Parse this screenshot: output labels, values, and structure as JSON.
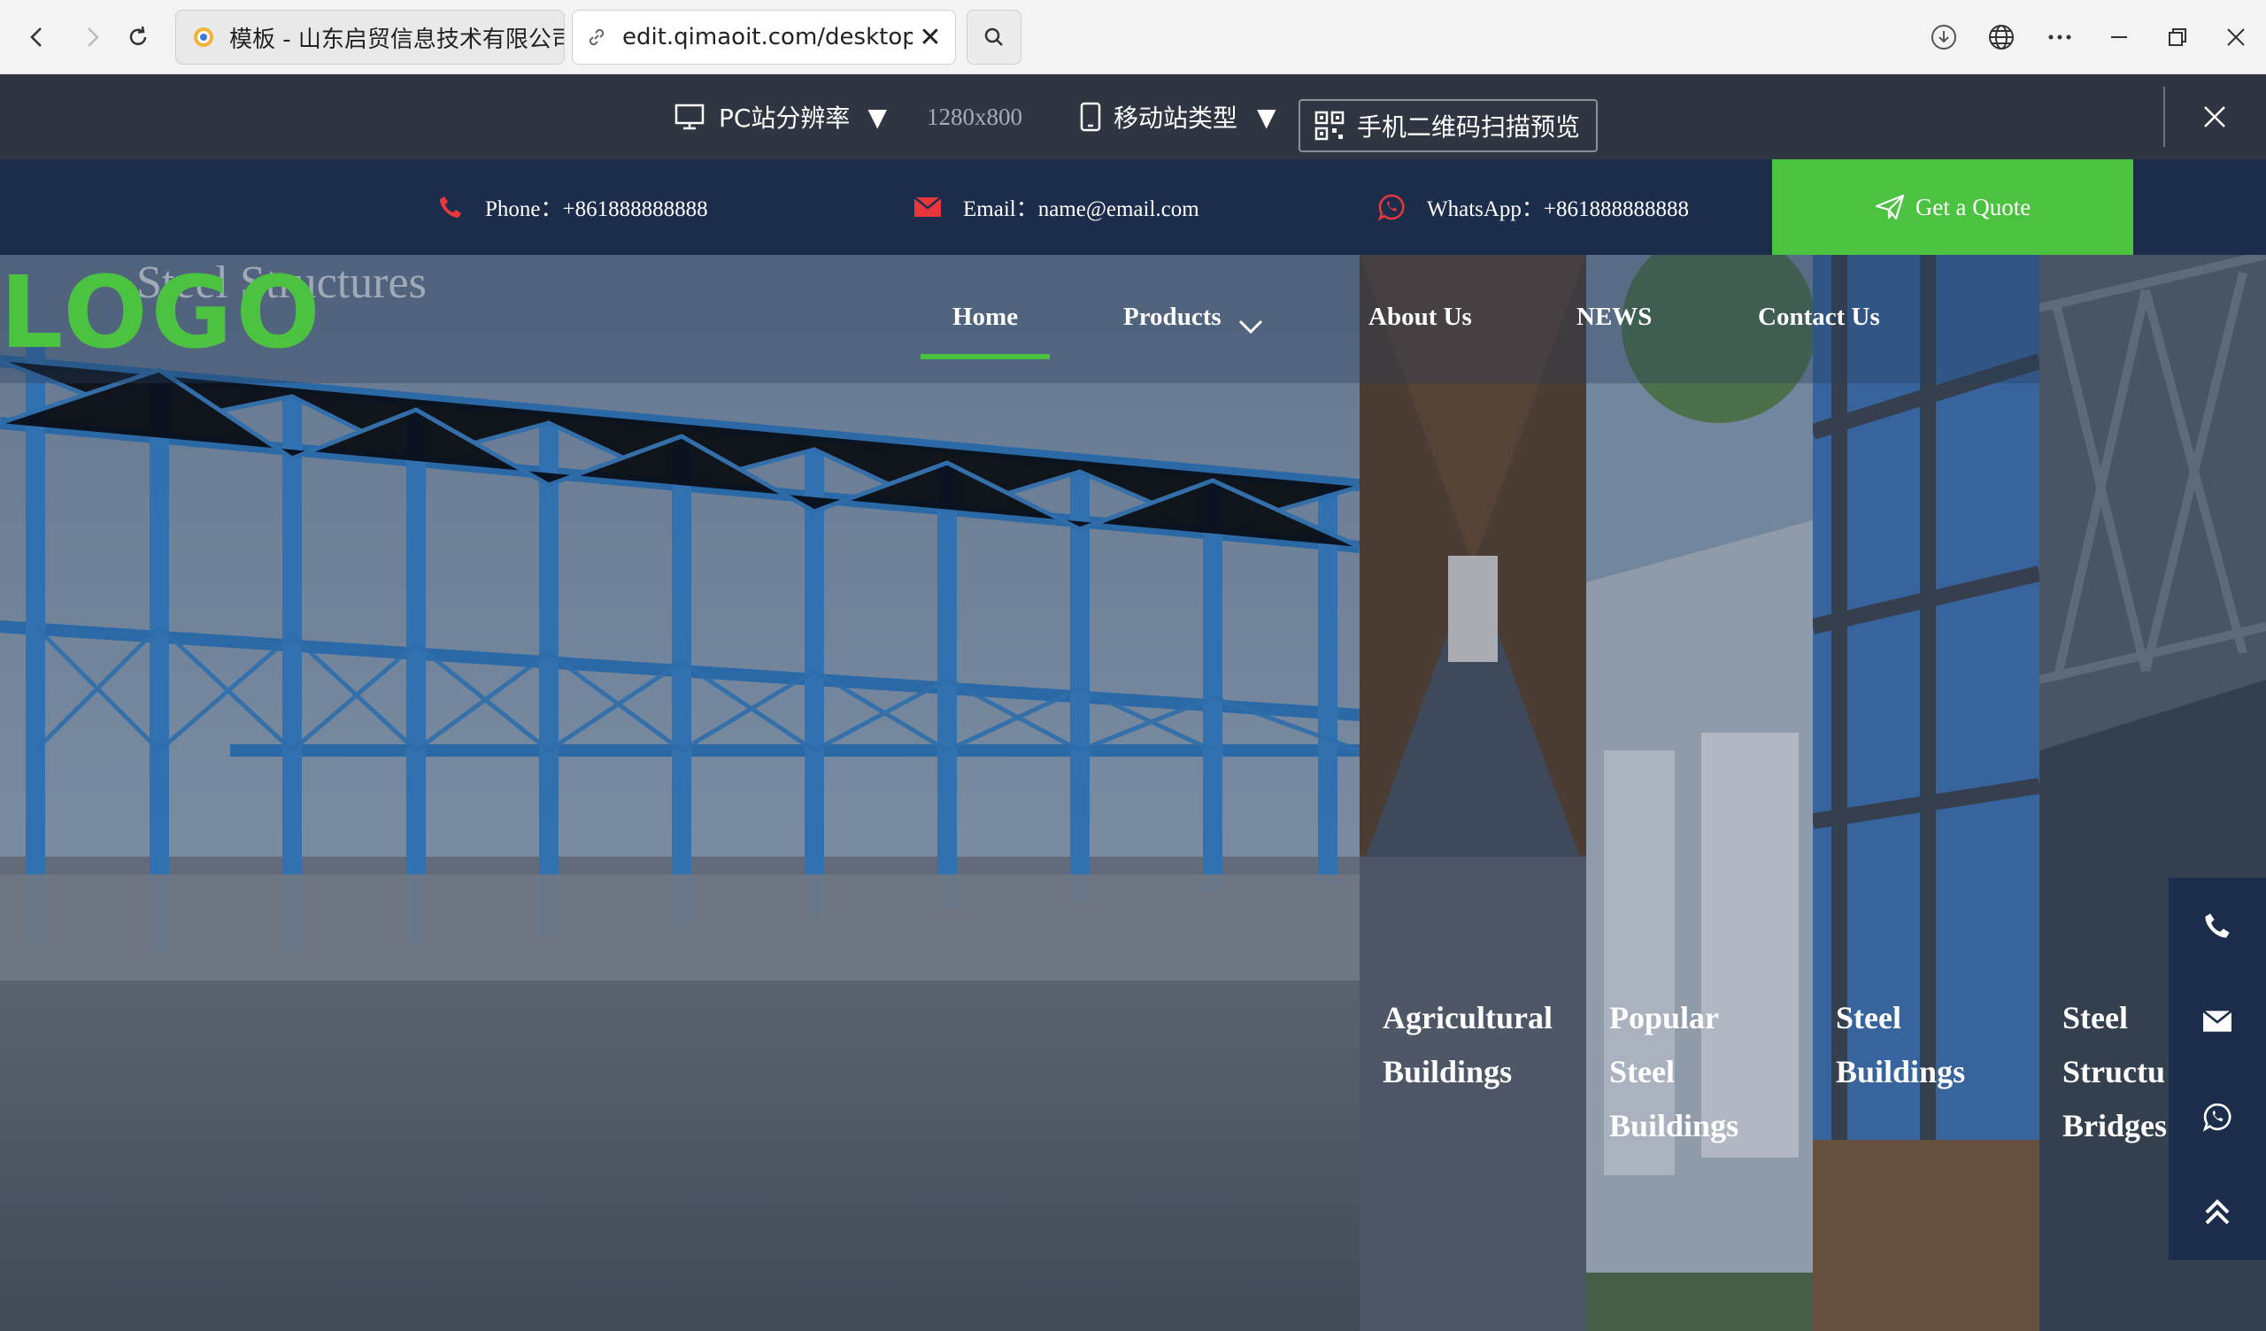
{
  "browser": {
    "tabs": [
      {
        "title": "模板 - 山东启贸信息技术有限公司",
        "active": false
      },
      {
        "title": "edit.qimaoit.com/desktop/h",
        "active": true
      }
    ],
    "icons": [
      "back-icon",
      "forward-icon",
      "reload-icon",
      "search-icon",
      "download-icon",
      "globe-icon",
      "more-icon",
      "minimize-icon",
      "restore-icon",
      "close-icon"
    ]
  },
  "preview_bar": {
    "pc_label": "PC站分辨率",
    "resolution": "1280x800",
    "mobile_label": "移动站类型",
    "qr_label": "手机二维码扫描预览",
    "arrow": "▼"
  },
  "contact": {
    "phone": "Phone：+861888888888",
    "email": "Email：name@email.com",
    "whatsapp": "WhatsApp：+861888888888",
    "quote": "Get a Quote"
  },
  "header": {
    "logo": "LOGO",
    "logo_subtitle": "Steel Structures",
    "nav": [
      {
        "label": "Home",
        "active": true
      },
      {
        "label": "Products",
        "has_dropdown": true
      },
      {
        "label": "About Us"
      },
      {
        "label": "NEWS"
      },
      {
        "label": "Contact Us"
      }
    ]
  },
  "hero": {
    "panels": [
      {
        "label": "Agricultural\nBuildings"
      },
      {
        "label": "Popular\nSteel\nBuildings"
      },
      {
        "label": "Steel\nBuildings"
      },
      {
        "label": "Steel\nStructu\nBridges"
      }
    ]
  },
  "colors": {
    "accent_green": "#4cc241",
    "navy": "#1c2d4b",
    "toolbar_gray": "#2f3541"
  }
}
